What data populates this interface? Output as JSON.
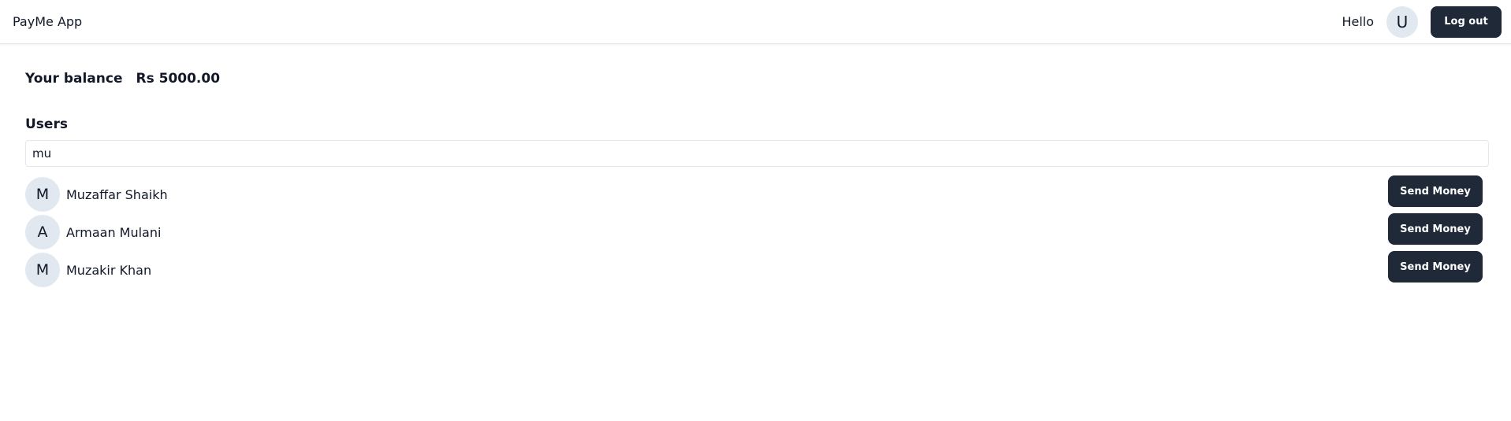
{
  "appbar": {
    "title": "PayMe App",
    "greeting": "Hello",
    "avatar_initial": "U",
    "logout_label": "Log out"
  },
  "balance": {
    "label": "Your balance",
    "value": "Rs 5000.00"
  },
  "users": {
    "title": "Users",
    "search_value": "mu",
    "send_label": "Send Money",
    "items": [
      {
        "initial": "M",
        "name": "Muzaffar Shaikh"
      },
      {
        "initial": "A",
        "name": "Armaan Mulani"
      },
      {
        "initial": "M",
        "name": "Muzakir Khan"
      }
    ]
  },
  "colors": {
    "button_bg": "#1f2937",
    "avatar_bg": "#e2e8f0",
    "border": "#e5e7eb"
  }
}
